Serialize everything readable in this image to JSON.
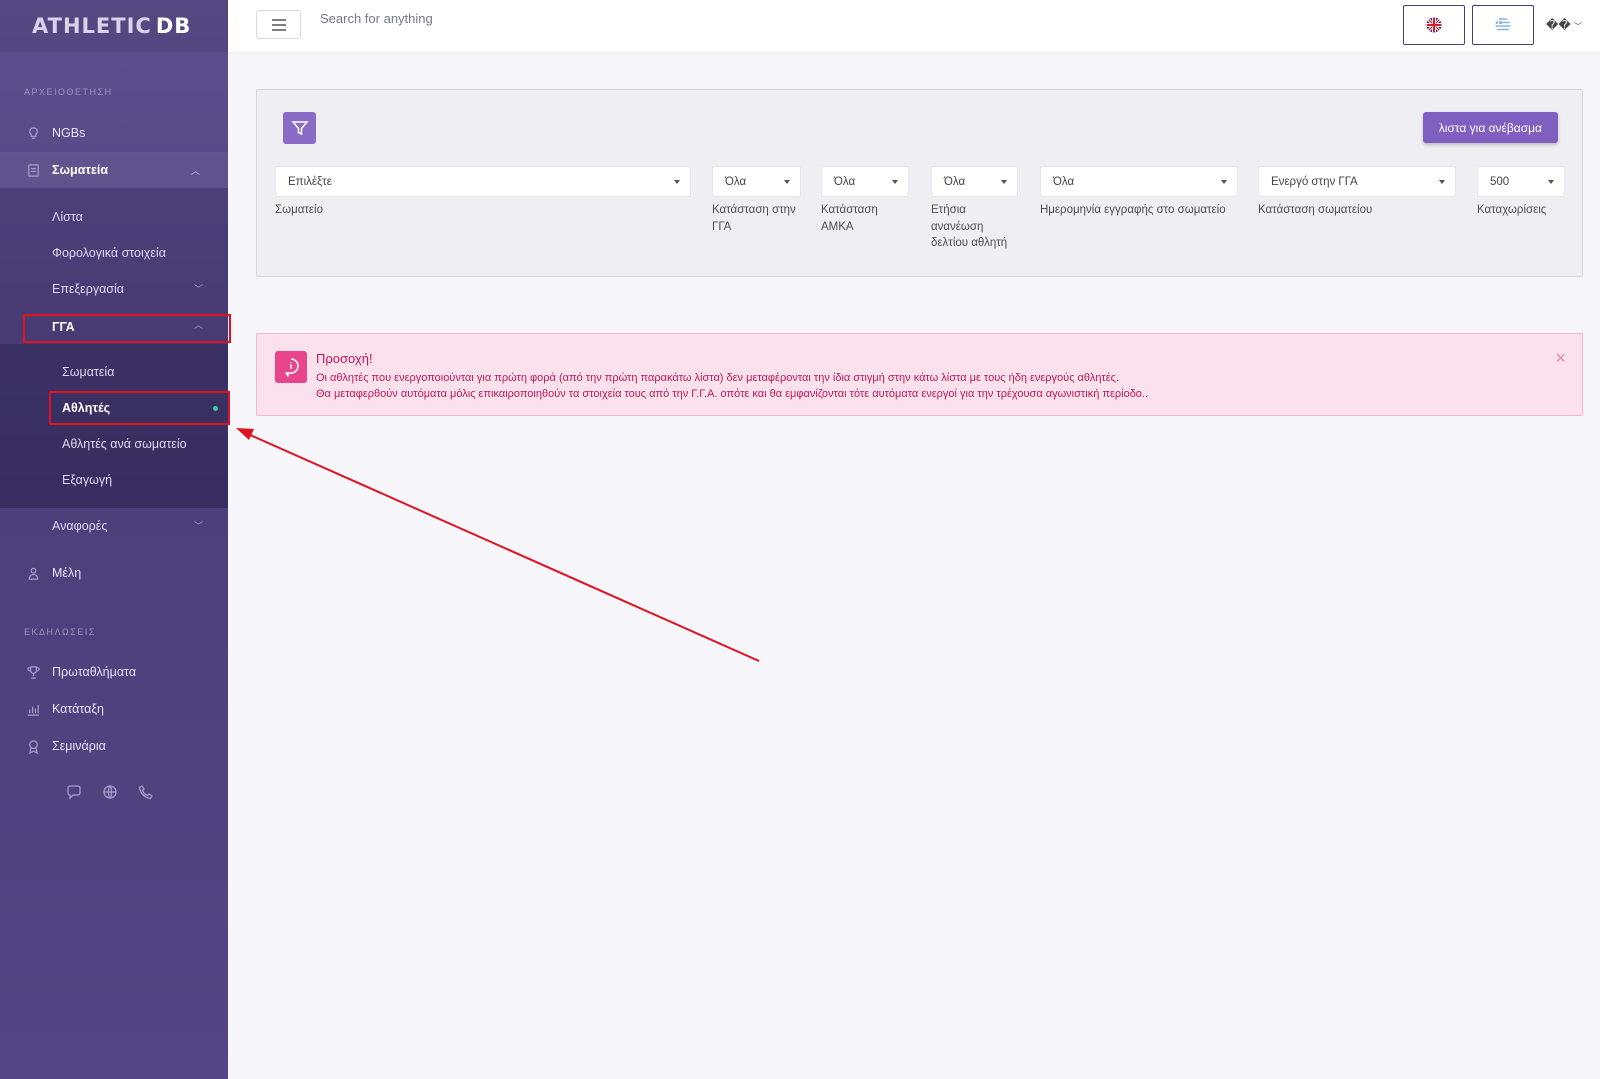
{
  "brand": {
    "logo_main": "ATHLETIC",
    "logo_suffix": "DB"
  },
  "topbar": {
    "search_placeholder": "Search for anything",
    "user_label": "��"
  },
  "sidebar": {
    "section1": "ΑΡΧΕΙΟΘΕΤΗΣΗ",
    "section2": "ΕΚΔΗΛΩΣΕΙΣ",
    "ngbs": "NGBs",
    "clubs": "Σωματεία",
    "list": "Λίστα",
    "tax": "Φορολογικά στοιχεία",
    "processing": "Επεξεργασία",
    "gga": "ΓΓΑ",
    "gga_clubs": "Σωματεία",
    "gga_athletes": "Αθλητές",
    "gga_athletes_per_club": "Αθλητές ανά σωματείο",
    "gga_export": "Εξαγωγή",
    "reports": "Αναφορές",
    "members": "Μέλη",
    "championships": "Πρωταθλήματα",
    "ranking": "Κατάταξη",
    "seminars": "Σεμινάρια"
  },
  "filters": {
    "upload_button": "λιστα για ανέβασμα",
    "club": {
      "value": "Επιλέξτε",
      "label": "Σωματείο"
    },
    "gga_status": {
      "value": "Όλα",
      "label": "Κατάσταση στην ΓΓΑ"
    },
    "amka_status": {
      "value": "Όλα",
      "label": "Κατάσταση ΑΜΚΑ"
    },
    "annual_renewal": {
      "value": "Όλα",
      "label": "Ετήσια ανανέωση δελτίου αθλητή"
    },
    "registration_date": {
      "value": "Όλα",
      "label": "Ημερομηνία εγγραφής στο σωματείο"
    },
    "club_status": {
      "value": "Ενεργό στην ΓΓΑ",
      "label": "Κατάσταση σωματείου"
    },
    "entries": {
      "value": "500",
      "label": "Καταχωρίσεις"
    }
  },
  "alert": {
    "title": "Προσοχή!",
    "line1": "Οι αθλητές που ενεργοποιούνται για πρώτη φορά (από την πρώτη παρακάτω λίστα) δεν μεταφέρονται την ίδια στιγμή στην κάτω λίστα με τους ήδη ενεργούς αθλητές.",
    "line2": "Θα μεταφερθούν αυτόματα μόλις επικαιροποιηθούν τα στοιχεία τους από την Γ.Γ.Α. οπότε και θα εμφανίζονται τότε αυτόματα ενεργοί για την τρέχουσα αγωνιστική περίοδο..",
    "close_icon": "×"
  },
  "colors": {
    "accent": "#7f5fbf",
    "highlight": "#e0121f",
    "alert_text": "#c2185b"
  }
}
